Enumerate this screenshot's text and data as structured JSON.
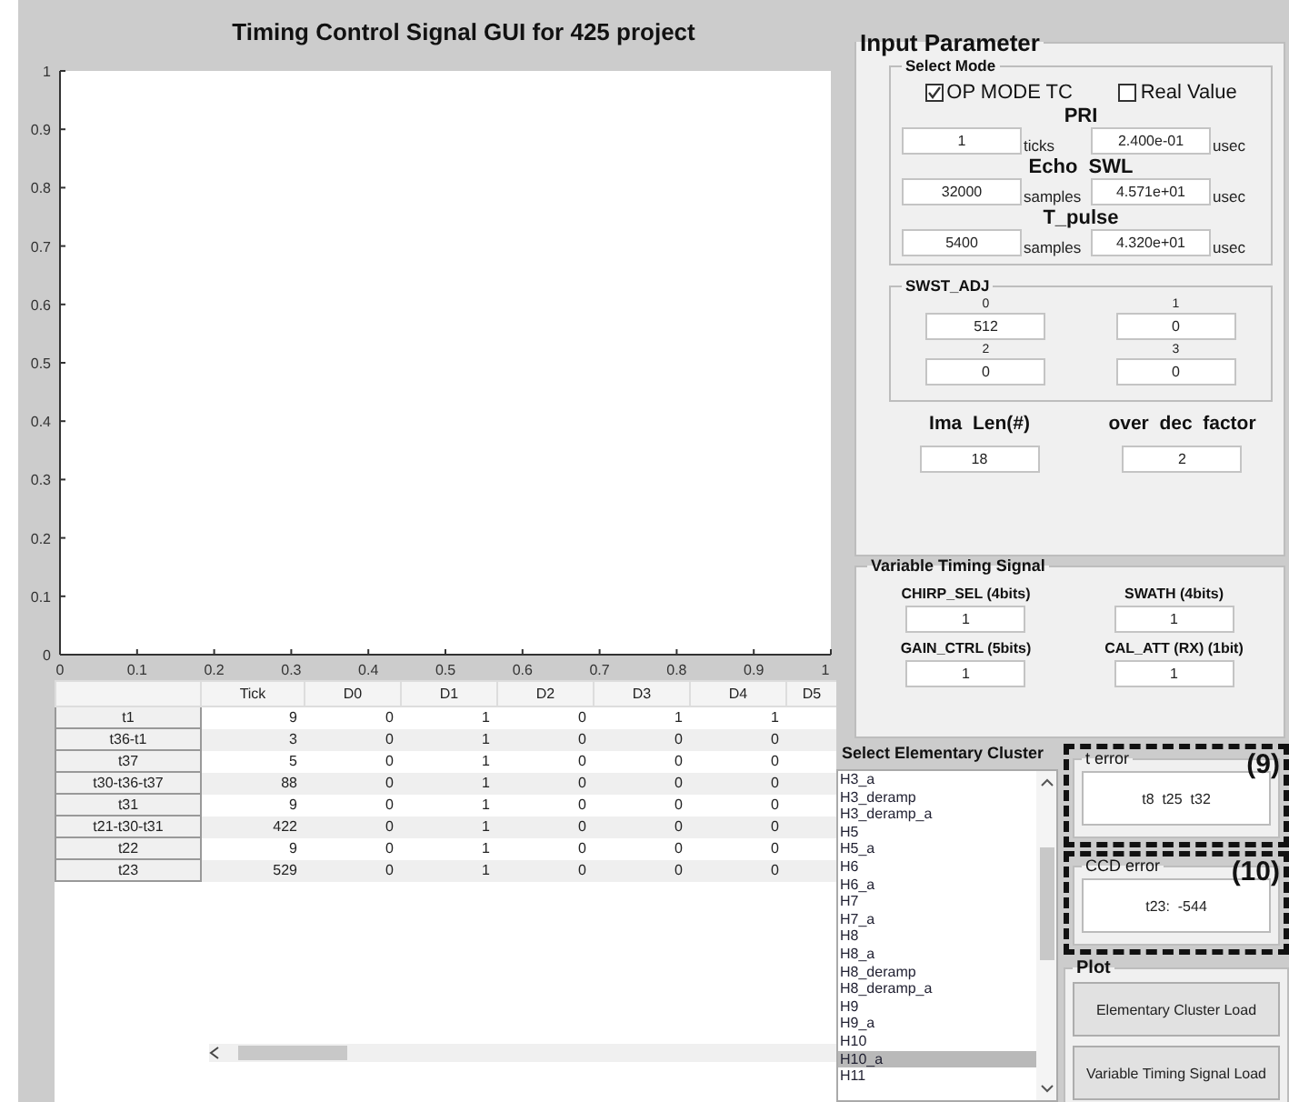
{
  "title": "Timing Control Signal GUI for 425 project",
  "chart_data": {
    "type": "line",
    "xlim": [
      0,
      1
    ],
    "ylim": [
      0,
      1
    ],
    "xticks": [
      0,
      0.1,
      0.2,
      0.3,
      0.4,
      0.5,
      0.6,
      0.7,
      0.8,
      0.9,
      1
    ],
    "yticks": [
      0,
      0.1,
      0.2,
      0.3,
      0.4,
      0.5,
      0.6,
      0.7,
      0.8,
      0.9,
      1
    ]
  },
  "table": {
    "columns": [
      "Tick",
      "D0",
      "D1",
      "D2",
      "D3",
      "D4",
      "D5"
    ],
    "rows": [
      {
        "header": "t1",
        "cells": [
          "9",
          "0",
          "1",
          "0",
          "1",
          "1"
        ]
      },
      {
        "header": "t36-t1",
        "cells": [
          "3",
          "0",
          "1",
          "0",
          "0",
          "0"
        ]
      },
      {
        "header": "t37",
        "cells": [
          "5",
          "0",
          "1",
          "0",
          "0",
          "0"
        ]
      },
      {
        "header": "t30-t36-t37",
        "cells": [
          "88",
          "0",
          "1",
          "0",
          "0",
          "0"
        ]
      },
      {
        "header": "t31",
        "cells": [
          "9",
          "0",
          "1",
          "0",
          "0",
          "0"
        ]
      },
      {
        "header": "t21-t30-t31",
        "cells": [
          "422",
          "0",
          "1",
          "0",
          "0",
          "0"
        ]
      },
      {
        "header": "t22",
        "cells": [
          "9",
          "0",
          "1",
          "0",
          "0",
          "0"
        ]
      },
      {
        "header": "t23",
        "cells": [
          "529",
          "0",
          "1",
          "0",
          "0",
          "0"
        ]
      }
    ]
  },
  "input_parameter": {
    "title": "Input Parameter",
    "select_mode": {
      "title": "Select Mode",
      "checkboxes": [
        {
          "label": "OP MODE TC",
          "checked": true
        },
        {
          "label": "Real Value",
          "checked": false
        }
      ],
      "params": [
        {
          "label": "PRI",
          "value": "1",
          "unit": "ticks",
          "converted": "2.400e-01",
          "converted_unit": "usec"
        },
        {
          "label": "Echo  SWL",
          "value": "32000",
          "unit": "samples",
          "converted": "4.571e+01",
          "converted_unit": "usec"
        },
        {
          "label": "T_pulse",
          "value": "5400",
          "unit": "samples",
          "converted": "4.320e+01",
          "converted_unit": "usec"
        }
      ]
    },
    "swst_adj": {
      "title": "SWST_ADJ",
      "fields": [
        {
          "label": "0",
          "value": "512"
        },
        {
          "label": "1",
          "value": "0"
        },
        {
          "label": "2",
          "value": "0"
        },
        {
          "label": "3",
          "value": "0"
        }
      ]
    },
    "extras": [
      {
        "label": "Ima  Len(#)",
        "value": "18"
      },
      {
        "label": "over  dec  factor",
        "value": "2"
      }
    ]
  },
  "variable_timing_signal": {
    "title": "Variable Timing Signal",
    "fields": [
      {
        "label": "CHIRP_SEL (4bits)",
        "value": "1"
      },
      {
        "label": "SWATH (4bits)",
        "value": "1"
      },
      {
        "label": "GAIN_CTRL (5bits)",
        "value": "1"
      },
      {
        "label": "CAL_ATT (RX) (1bit)",
        "value": "1"
      }
    ]
  },
  "cluster_list": {
    "title": "Select Elementary Cluster",
    "items": [
      {
        "label": "H3_a",
        "selected": false
      },
      {
        "label": "H3_deramp",
        "selected": false
      },
      {
        "label": "H3_deramp_a",
        "selected": false
      },
      {
        "label": "H5",
        "selected": false
      },
      {
        "label": "H5_a",
        "selected": false
      },
      {
        "label": "H6",
        "selected": false
      },
      {
        "label": "H6_a",
        "selected": false
      },
      {
        "label": "H7",
        "selected": false
      },
      {
        "label": "H7_a",
        "selected": false
      },
      {
        "label": "H8",
        "selected": false
      },
      {
        "label": "H8_a",
        "selected": false
      },
      {
        "label": "H8_deramp",
        "selected": false
      },
      {
        "label": "H8_deramp_a",
        "selected": false
      },
      {
        "label": "H9",
        "selected": false
      },
      {
        "label": "H9_a",
        "selected": false
      },
      {
        "label": "H10",
        "selected": false
      },
      {
        "label": "H10_a",
        "selected": true
      },
      {
        "label": "H11",
        "selected": false
      }
    ]
  },
  "errors": [
    {
      "title": "t error",
      "value": "t8  t25  t32",
      "callout": "(9)"
    },
    {
      "title": "CCD error",
      "value": "t23:  -544",
      "callout": "(10)"
    }
  ],
  "plot": {
    "title": "Plot",
    "buttons": [
      "Elementary Cluster Load",
      "Variable Timing Signal Load"
    ]
  }
}
